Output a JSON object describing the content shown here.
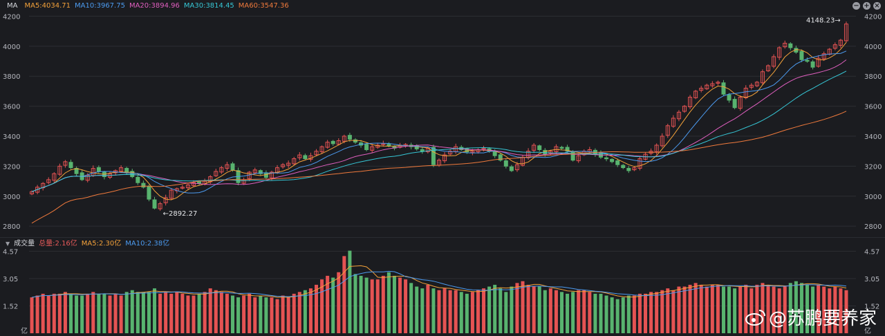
{
  "header": {
    "indicator": "MA",
    "ma_labels": [
      {
        "text": "MA5:4034.71",
        "color": "#f4a23a"
      },
      {
        "text": "MA10:3967.75",
        "color": "#4c9bf0"
      },
      {
        "text": "MA20:3894.96",
        "color": "#e05fbf"
      },
      {
        "text": "MA30:3814.45",
        "color": "#36c7d6"
      },
      {
        "text": "MA60:3547.36",
        "color": "#f07a3c"
      }
    ],
    "buttons": [
      "−",
      "+",
      "×"
    ]
  },
  "volume_header": {
    "label": "成交量",
    "items": [
      {
        "text": "总量:2.16亿",
        "color": "#e65a5a"
      },
      {
        "text": "MA5:2.30亿",
        "color": "#f4a23a"
      },
      {
        "text": "MA10:2.38亿",
        "color": "#4c9bf0"
      }
    ]
  },
  "watermark": "@苏鹏要养家",
  "colors": {
    "up": "#e55353",
    "down": "#58b36f",
    "grid": "#2c2e33",
    "text": "#b6b8bf"
  },
  "chart_data": [
    {
      "type": "candlestick",
      "title": "",
      "y_ticks": [
        2800,
        3000,
        3200,
        3400,
        3600,
        3800,
        4000,
        4200
      ],
      "ylim": [
        2750,
        4225
      ],
      "annotations": [
        {
          "text": "←2892.27",
          "value": 2892.27
        },
        {
          "text": "4148.23→",
          "value": 4148.23
        }
      ],
      "close": [
        3030,
        3060,
        3085,
        3110,
        3150,
        3200,
        3230,
        3190,
        3150,
        3110,
        3140,
        3185,
        3165,
        3130,
        3150,
        3170,
        3190,
        3160,
        3130,
        3090,
        3060,
        2980,
        2920,
        2950,
        2990,
        3040,
        3050,
        3060,
        3075,
        3090,
        3085,
        3100,
        3130,
        3165,
        3190,
        3210,
        3175,
        3090,
        3110,
        3160,
        3175,
        3150,
        3125,
        3160,
        3190,
        3210,
        3220,
        3250,
        3275,
        3250,
        3270,
        3300,
        3330,
        3360,
        3350,
        3370,
        3400,
        3380,
        3360,
        3340,
        3310,
        3330,
        3340,
        3350,
        3335,
        3320,
        3340,
        3345,
        3330,
        3315,
        3300,
        3320,
        3210,
        3240,
        3275,
        3300,
        3330,
        3310,
        3295,
        3300,
        3310,
        3320,
        3300,
        3270,
        3240,
        3200,
        3170,
        3210,
        3260,
        3300,
        3340,
        3310,
        3280,
        3300,
        3330,
        3320,
        3300,
        3240,
        3270,
        3300,
        3310,
        3280,
        3260,
        3250,
        3230,
        3210,
        3190,
        3170,
        3190,
        3250,
        3280,
        3300,
        3340,
        3400,
        3470,
        3520,
        3560,
        3600,
        3660,
        3700,
        3720,
        3740,
        3750,
        3760,
        3680,
        3640,
        3590,
        3660,
        3720,
        3740,
        3760,
        3830,
        3870,
        3930,
        3990,
        4020,
        3990,
        3960,
        3910,
        3900,
        3860,
        3920,
        3950,
        3980,
        4010,
        4040,
        4148
      ],
      "volume_unit": "亿",
      "volume_ticks": [
        1.52,
        3.05,
        4.57
      ],
      "volume_labels": [
        "1.52",
        "3.05",
        "4.57"
      ],
      "volume_ylim": [
        0,
        4.7
      ],
      "volumes": [
        2.0,
        2.1,
        2.2,
        2.1,
        2.2,
        2.2,
        2.3,
        2.2,
        2.1,
        2.1,
        2.2,
        2.3,
        2.2,
        2.2,
        2.1,
        2.2,
        2.1,
        2.3,
        2.4,
        2.3,
        2.3,
        2.3,
        2.5,
        2.2,
        2.3,
        2.2,
        2.3,
        2.2,
        2.1,
        2.1,
        2.2,
        2.3,
        2.5,
        2.4,
        2.3,
        2.2,
        2.1,
        2.0,
        2.1,
        2.2,
        2.0,
        2.1,
        2.0,
        2.0,
        1.9,
        2.1,
        2.0,
        2.2,
        2.3,
        2.4,
        2.5,
        2.7,
        3.0,
        3.2,
        3.1,
        3.4,
        4.3,
        4.6,
        3.3,
        3.2,
        3.1,
        3.0,
        3.0,
        3.2,
        3.4,
        3.2,
        3.1,
        3.0,
        2.8,
        2.6,
        2.5,
        2.7,
        2.5,
        2.4,
        2.5,
        2.4,
        2.4,
        2.3,
        2.2,
        2.3,
        2.4,
        2.5,
        2.6,
        2.7,
        2.5,
        2.3,
        2.6,
        2.8,
        2.9,
        2.7,
        2.6,
        2.6,
        2.4,
        2.5,
        2.4,
        2.3,
        2.2,
        2.3,
        2.4,
        2.4,
        2.3,
        2.2,
        2.2,
        2.1,
        2.0,
        1.9,
        2.0,
        2.1,
        2.1,
        2.2,
        2.2,
        2.3,
        2.3,
        2.4,
        2.5,
        2.4,
        2.6,
        2.6,
        2.7,
        2.8,
        2.7,
        2.6,
        2.7,
        2.7,
        2.6,
        2.6,
        2.5,
        2.6,
        2.7,
        2.5,
        2.7,
        2.8,
        2.7,
        2.6,
        2.5,
        2.6,
        2.8,
        2.9,
        2.8,
        2.7,
        2.6,
        2.7,
        2.6,
        2.5,
        2.6,
        2.5,
        2.4
      ]
    }
  ]
}
